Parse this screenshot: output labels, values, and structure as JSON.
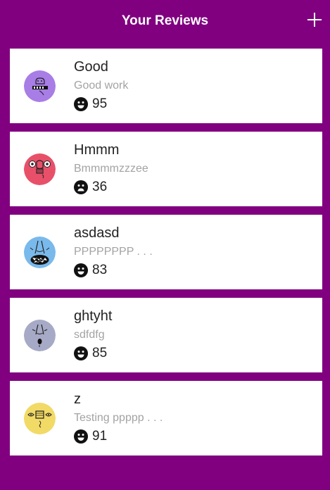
{
  "header": {
    "title": "Your Reviews",
    "add_icon": "plus-icon"
  },
  "reviews": [
    {
      "title": "Good",
      "subtitle": "Good work",
      "score": "95",
      "mood": "happy-face-icon",
      "avatar_color": "#a87de6"
    },
    {
      "title": "Hmmm",
      "subtitle": "Bmmmmzzzee",
      "score": "36",
      "mood": "sad-face-icon",
      "avatar_color": "#e8506a"
    },
    {
      "title": "asdasd",
      "subtitle": "PPPPPPPP . . .",
      "score": "83",
      "mood": "happy-face-icon",
      "avatar_color": "#79b9ec"
    },
    {
      "title": "ghtyht",
      "subtitle": "sdfdfg",
      "score": "85",
      "mood": "happy-face-icon",
      "avatar_color": "#a6aac6"
    },
    {
      "title": "z",
      "subtitle": "Testing ppppp . . .",
      "score": "91",
      "mood": "happy-face-icon",
      "avatar_color": "#f1da66"
    }
  ]
}
